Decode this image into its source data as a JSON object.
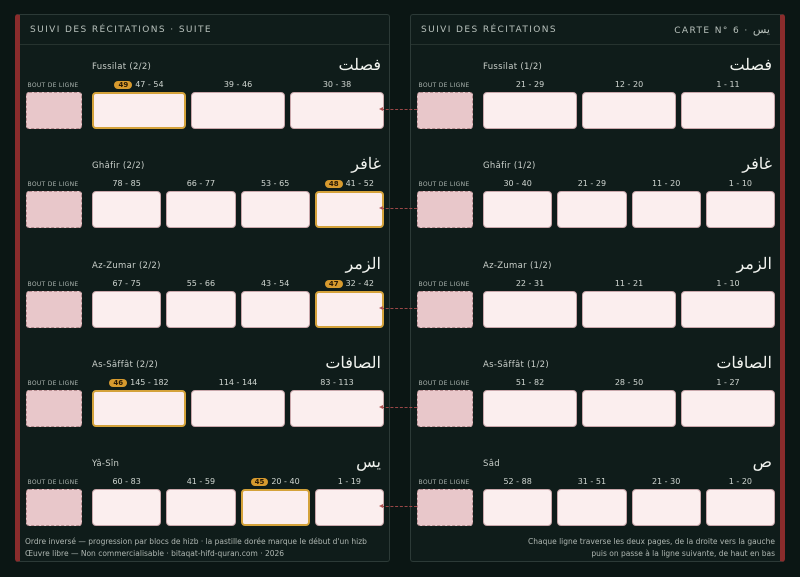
{
  "left_page": {
    "title": "SUIVI DES RÉCITATIONS · SUITE",
    "end_of_line_label": "BOUT DE LIGNE",
    "sections": [
      {
        "name": "Fussilat (2/2)",
        "arabic": "فصلت",
        "cells": [
          {
            "range": "47 - 54",
            "badge": "49",
            "gold": true
          },
          {
            "range": "39 - 46"
          },
          {
            "range": "30 - 38"
          }
        ]
      },
      {
        "name": "Ghâfir (2/2)",
        "arabic": "غافر",
        "cells": [
          {
            "range": "78 - 85"
          },
          {
            "range": "66 - 77"
          },
          {
            "range": "53 - 65"
          },
          {
            "range": "41 - 52",
            "badge": "48",
            "gold": true
          }
        ]
      },
      {
        "name": "Az-Zumar (2/2)",
        "arabic": "الزمر",
        "cells": [
          {
            "range": "67 - 75"
          },
          {
            "range": "55 - 66"
          },
          {
            "range": "43 - 54"
          },
          {
            "range": "32 - 42",
            "badge": "47",
            "gold": true
          }
        ]
      },
      {
        "name": "As-Sâffât (2/2)",
        "arabic": "الصافات",
        "cells": [
          {
            "range": "145 - 182",
            "badge": "46",
            "gold": true
          },
          {
            "range": "114 - 144"
          },
          {
            "range": "83 - 113"
          }
        ]
      },
      {
        "name": "Yâ-Sîn",
        "arabic": "يس",
        "cells": [
          {
            "range": "60 - 83"
          },
          {
            "range": "41 - 59"
          },
          {
            "range": "20 - 40",
            "badge": "45",
            "gold": true
          },
          {
            "range": "1 - 19"
          }
        ]
      }
    ],
    "footer_line1": "Ordre inversé — progression par blocs de hizb · la pastille dorée marque le début d'un hizb",
    "footer_line2": "Œuvre libre — Non commercialisable · bitaqat-hifd-quran.com · 2026"
  },
  "right_page": {
    "title": "SUIVI DES RÉCITATIONS",
    "card_label": "CARTE N° 6 ·",
    "card_arabic": "يس",
    "end_of_line_label": "BOUT DE LIGNE",
    "sections": [
      {
        "name": "Fussilat (1/2)",
        "arabic": "فصلت",
        "cells": [
          {
            "range": "21 - 29"
          },
          {
            "range": "12 - 20"
          },
          {
            "range": "1 - 11"
          }
        ]
      },
      {
        "name": "Ghâfir (1/2)",
        "arabic": "غافر",
        "cells": [
          {
            "range": "30 - 40"
          },
          {
            "range": "21 - 29"
          },
          {
            "range": "11 - 20"
          },
          {
            "range": "1 - 10"
          }
        ]
      },
      {
        "name": "Az-Zumar (1/2)",
        "arabic": "الزمر",
        "cells": [
          {
            "range": "22 - 31"
          },
          {
            "range": "11 - 21"
          },
          {
            "range": "1 - 10"
          }
        ]
      },
      {
        "name": "As-Sâffât (1/2)",
        "arabic": "الصافات",
        "cells": [
          {
            "range": "51 - 82"
          },
          {
            "range": "28 - 50"
          },
          {
            "range": "1 - 27"
          }
        ]
      },
      {
        "name": "Sâd",
        "arabic": "ص",
        "cells": [
          {
            "range": "52 - 88"
          },
          {
            "range": "31 - 51"
          },
          {
            "range": "21 - 30"
          },
          {
            "range": "1 - 20"
          }
        ]
      }
    ],
    "footer_line1": "Chaque ligne traverse les deux pages, de la droite vers la gauche",
    "footer_line2": "puis on passe à la ligne suivante, de haut en bas"
  }
}
